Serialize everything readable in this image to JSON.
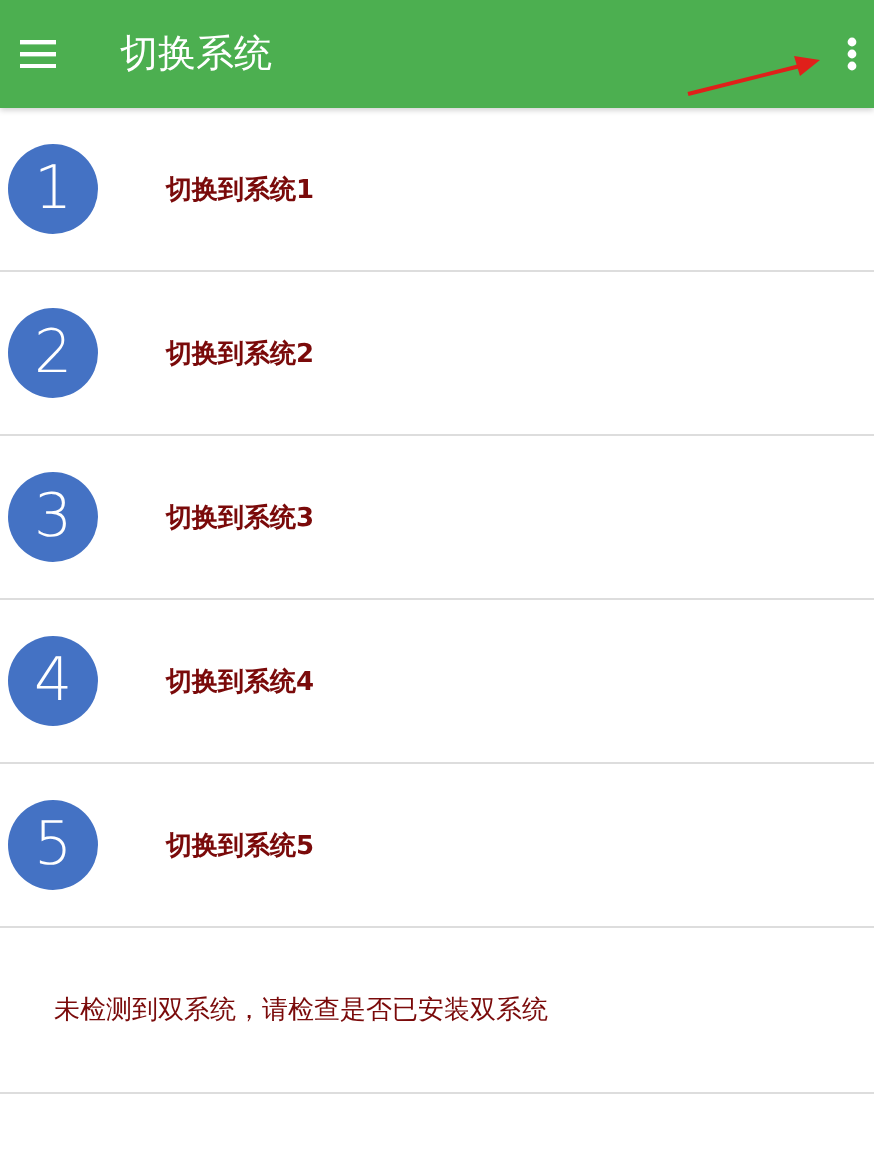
{
  "app_bar": {
    "title": "切换系统"
  },
  "systems": [
    {
      "number": "1",
      "label": "切换到系统1"
    },
    {
      "number": "2",
      "label": "切换到系统2"
    },
    {
      "number": "3",
      "label": "切换到系统3"
    },
    {
      "number": "4",
      "label": "切换到系统4"
    },
    {
      "number": "5",
      "label": "切换到系统5"
    }
  ],
  "notice": "未检测到双系统，请检查是否已安装双系统"
}
